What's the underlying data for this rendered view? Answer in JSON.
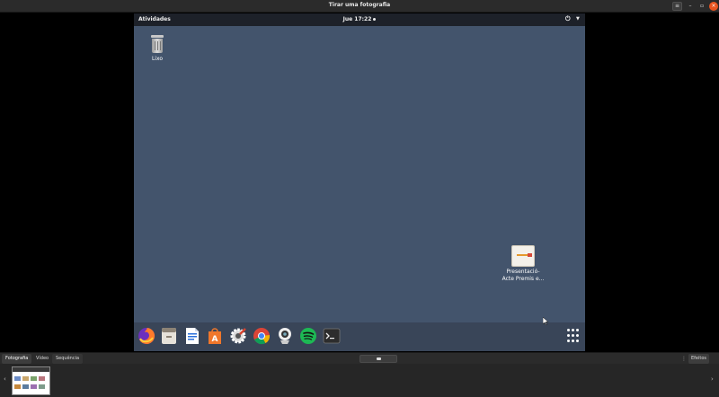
{
  "window": {
    "title": "Tirar uma fotografia",
    "menu_icon": "hamburger-menu-icon",
    "minimize_glyph": "–",
    "maximize_glyph": "▫",
    "close_glyph": "×"
  },
  "preview": {
    "topbar": {
      "activities": "Atividades",
      "clock": "Jue 17:22",
      "power_icon": "power-icon",
      "menu_arrow_icon": "chevron-down-icon"
    },
    "desktop": {
      "background_color": "#43546c",
      "icons": [
        {
          "label": "Lixo",
          "icon": "trash-icon"
        },
        {
          "label": "Presentació-Acte Premis e...",
          "icon": "presentation-file-icon"
        }
      ]
    },
    "dock": {
      "apps": [
        {
          "name": "firefox-icon"
        },
        {
          "name": "file-manager-icon"
        },
        {
          "name": "text-document-icon"
        },
        {
          "name": "software-center-icon"
        },
        {
          "name": "system-settings-icon"
        },
        {
          "name": "chrome-icon"
        },
        {
          "name": "webcam-app-icon"
        },
        {
          "name": "spotify-icon"
        },
        {
          "name": "terminal-icon"
        }
      ],
      "show_apps_icon": "app-grid-icon"
    }
  },
  "bottombar": {
    "tabs": [
      {
        "label": "Fotografia",
        "active": true
      },
      {
        "label": "Vídeo",
        "active": false
      },
      {
        "label": "Sequência",
        "active": false
      }
    ],
    "effects_label": "Efeitos"
  },
  "colors": {
    "accent_close": "#e95420",
    "topbar": "#1d2129",
    "chrome": "#2b2b2b"
  }
}
